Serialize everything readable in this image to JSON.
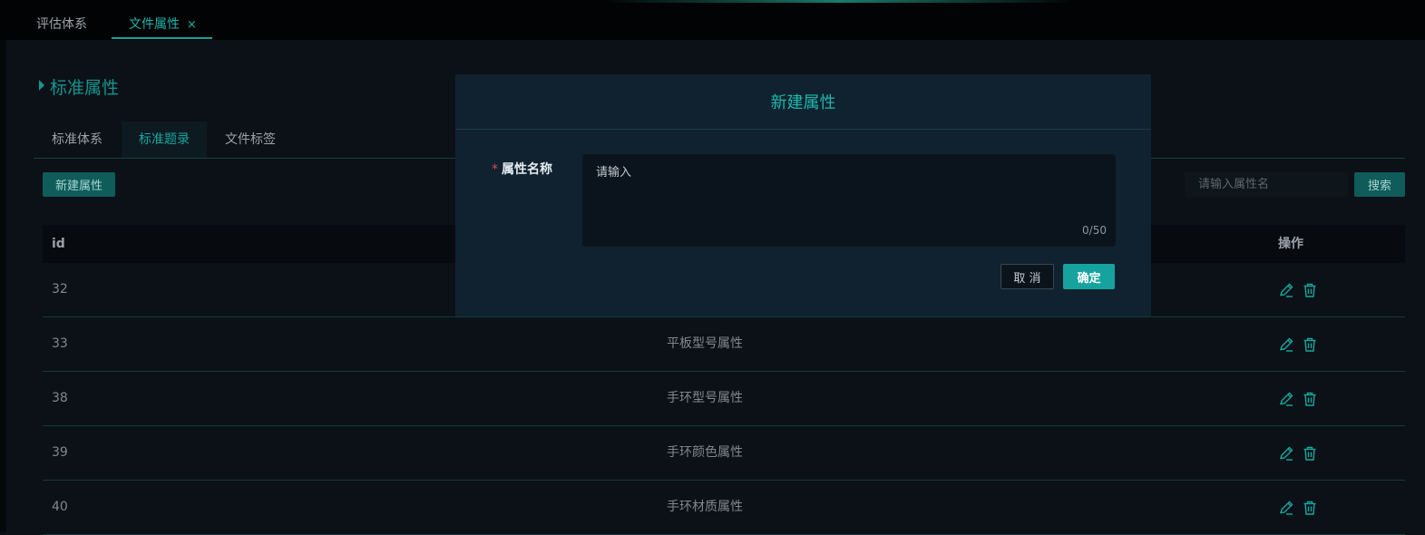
{
  "app_tabs": [
    {
      "label": "评估体系",
      "active": false
    },
    {
      "label": "文件属性",
      "active": true,
      "close": "×"
    }
  ],
  "section": {
    "title": "标准属性"
  },
  "sub_tabs": [
    {
      "label": "标准体系"
    },
    {
      "label": "标准题录",
      "active": true
    },
    {
      "label": "文件标签"
    }
  ],
  "toolbar": {
    "new_label": "新建属性",
    "search_placeholder": "请输入属性名",
    "search_label": "搜索"
  },
  "table": {
    "headers": {
      "id": "id",
      "name": "",
      "ops": "操作"
    },
    "rows": [
      {
        "id": "32",
        "name": ""
      },
      {
        "id": "33",
        "name": "平板型号属性"
      },
      {
        "id": "38",
        "name": "手环型号属性"
      },
      {
        "id": "39",
        "name": "手环颜色属性"
      },
      {
        "id": "40",
        "name": "手环材质属性"
      }
    ]
  },
  "modal": {
    "title": "新建属性",
    "required_mark": "*",
    "field_label": "属性名称",
    "placeholder": "请输入",
    "counter": "0/50",
    "cancel_label": "取 消",
    "ok_label": "确定"
  },
  "colors": {
    "accent": "#16a39b",
    "button_bg": "#0f5c5a",
    "ok_bg": "#16a3a0",
    "modal_bg": "#10222f",
    "required": "#e04b4b"
  },
  "icons": {
    "edit": "edit-icon",
    "delete": "trash-icon"
  }
}
